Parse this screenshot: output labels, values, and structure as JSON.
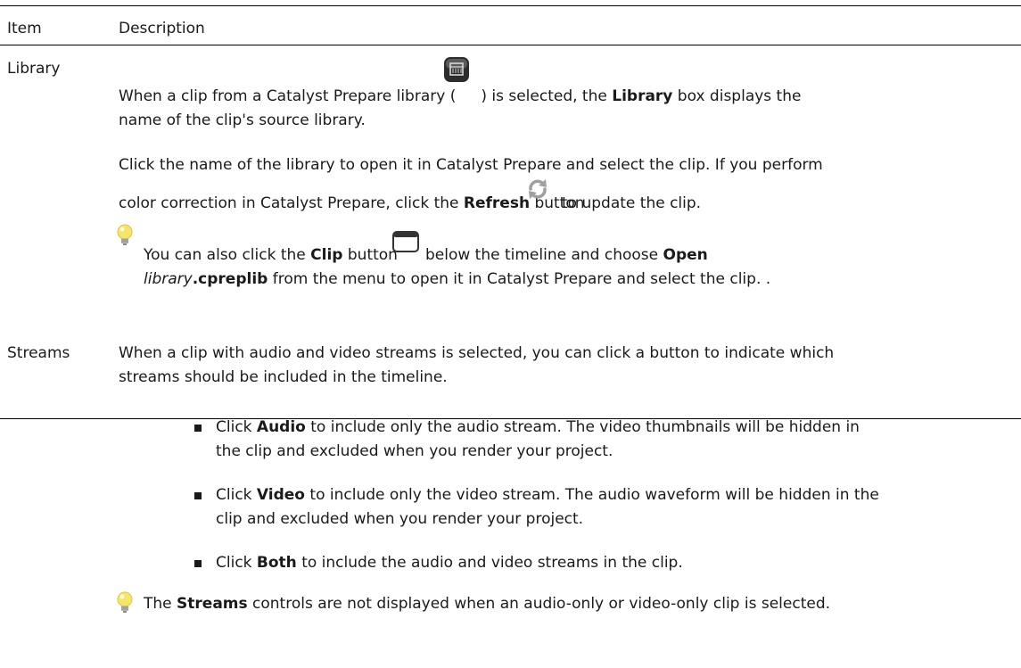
{
  "header": {
    "col1": "Item",
    "col2": "Description"
  },
  "library": {
    "label": "Library",
    "p1_a": "When a clip from a Catalyst Prepare library (",
    "p1_b": ") is selected, the ",
    "p1_bold": "Library",
    "p1_c": " box displays the",
    "p1_line2": "name of the clip's source library.",
    "p2_line1": "Click the name of the library to open it in Catalyst Prepare and select the clip. If you perform",
    "p2_a": "color correction in Catalyst Prepare, click the ",
    "p2_bold": "Refresh",
    "p2_b": " button",
    "p2_c": "to update the clip.",
    "tip_a": "You can also click the ",
    "tip_bold1": "Clip",
    "tip_b": " button",
    "tip_c": "below the timeline and choose ",
    "tip_bold2": "Open",
    "tip2_italic": "library",
    "tip2_bold": ".cpreplib",
    "tip2_rest": " from the menu to open it in Catalyst Prepare and select the clip. ."
  },
  "streams": {
    "label": "Streams",
    "intro_line1": "When a clip with audio and video streams is selected, you can click a button to indicate which",
    "intro_line2": "streams should be included in the timeline.",
    "bullets": [
      {
        "pre": "Click ",
        "bold": "Audio",
        "post": " to include only the audio stream. The video thumbnails will be hidden in",
        "line2": "the clip and excluded when you render your project."
      },
      {
        "pre": "Click ",
        "bold": "Video",
        "post": " to include only the video stream. The audio waveform will be hidden in the",
        "line2": "clip and excluded when you render your project."
      },
      {
        "pre": "Click ",
        "bold": "Both",
        "post": " to include the audio and video streams in the clip."
      }
    ],
    "tip_a": "The ",
    "tip_bold": "Streams",
    "tip_b": " controls are not displayed when an audio-only or video-only clip is selected."
  },
  "icons": {
    "library": "library-icon",
    "refresh": "refresh-icon",
    "clip": "clip-window-icon",
    "tip": "lightbulb-tip-icon"
  },
  "colors": {
    "refresh": "#a0a0a0",
    "bulb": "#f5e66a",
    "library_icon": "#2c2c2c"
  }
}
